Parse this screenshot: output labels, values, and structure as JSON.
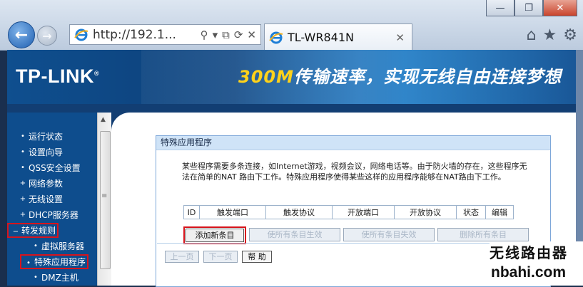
{
  "browser": {
    "address": "http://192.1...",
    "tab_title": "TL-WR841N",
    "window_buttons": [
      "—",
      "❐",
      "✕"
    ],
    "toolbar_icons": [
      "home-icon",
      "star-icon",
      "gear-icon"
    ]
  },
  "banner": {
    "logo": "TP-LINK",
    "logo_mark": "®",
    "slogan_highlight": "300M",
    "slogan_rest": "传输速率，实现无线自由连接梦想"
  },
  "sidebar": {
    "items": [
      {
        "bullet": "•",
        "label": "运行状态"
      },
      {
        "bullet": "•",
        "label": "设置向导"
      },
      {
        "bullet": "•",
        "label": "QSS安全设置"
      },
      {
        "bullet": "+",
        "label": "网络参数"
      },
      {
        "bullet": "+",
        "label": "无线设置"
      },
      {
        "bullet": "+",
        "label": "DHCP服务器"
      },
      {
        "bullet": "−",
        "label": "转发规则"
      },
      {
        "bullet": "•",
        "label": "虚拟服务器"
      },
      {
        "bullet": "•",
        "label": "特殊应用程序"
      },
      {
        "bullet": "•",
        "label": "DMZ主机"
      }
    ]
  },
  "panel": {
    "title": "特殊应用程序",
    "description": "某些程序需要多条连接，如Internet游戏，视频会议，网络电话等。由于防火墙的存在，这些程序无法在简单的NAT 路由下工作。特殊应用程序使得某些这样的应用程序能够在NAT路由下工作。",
    "table_headers": [
      "ID",
      "触发端口",
      "触发协议",
      "开放端口",
      "开放协议",
      "状态",
      "编辑"
    ],
    "buttons": {
      "add": "添加新条目",
      "enable_all": "使所有条目生效",
      "disable_all": "使所有条目失效",
      "delete_all": "删除所有条目"
    },
    "pager": {
      "prev": "上一页",
      "next": "下一页",
      "help": "帮 助"
    }
  },
  "watermark": {
    "line1": "无线路由器",
    "line2": "nbahi.com"
  },
  "colors": {
    "sidebar": "#0e4d8d",
    "highlight_box": "#d8141c",
    "panel_title_bg": "#cfe3f7",
    "slogan_highlight": "#ffd21a"
  }
}
